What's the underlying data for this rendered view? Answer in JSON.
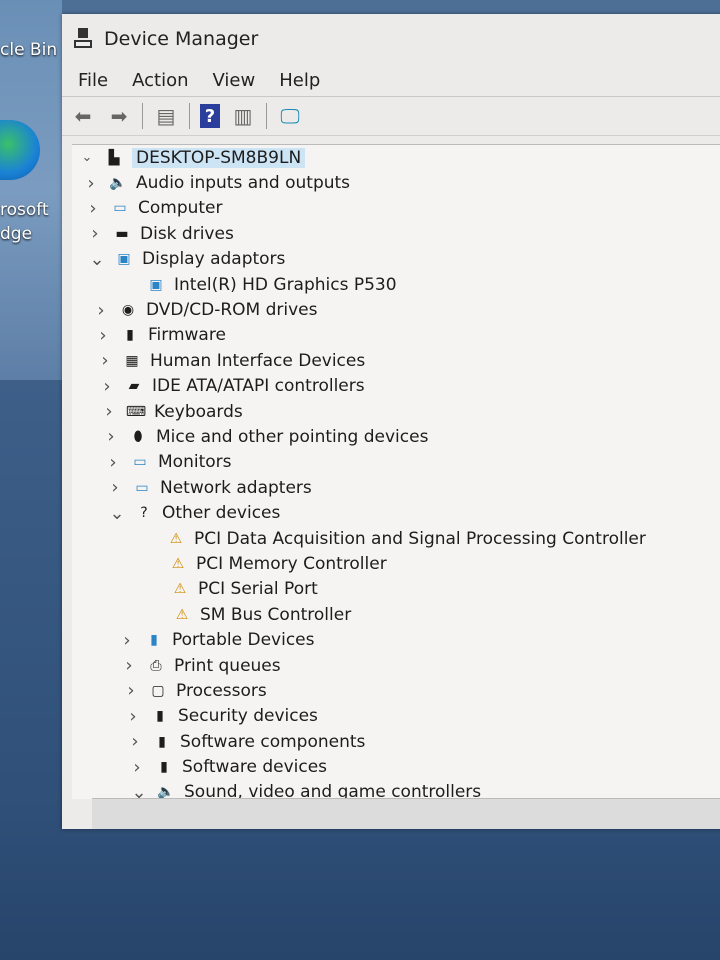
{
  "desktop": {
    "labels": [
      "cle Bin",
      "rosoft",
      "dge"
    ]
  },
  "window": {
    "title": "Device Manager"
  },
  "menu": [
    "File",
    "Action",
    "View",
    "Help"
  ],
  "tree": {
    "root": "DESKTOP-SM8B9LN",
    "items": [
      {
        "label": "Audio inputs and outputs",
        "state": "collapsed",
        "icon": "speaker-icon",
        "level": 1
      },
      {
        "label": "Computer",
        "state": "collapsed",
        "icon": "monitor-icon",
        "level": 1
      },
      {
        "label": "Disk drives",
        "state": "collapsed",
        "icon": "disk-icon",
        "level": 1
      },
      {
        "label": "Display adaptors",
        "state": "expanded",
        "icon": "display-adapter-icon",
        "level": 1
      },
      {
        "label": "Intel(R) HD Graphics P530",
        "state": "leaf",
        "icon": "display-adapter-icon",
        "level": 2
      },
      {
        "label": "DVD/CD-ROM drives",
        "state": "collapsed",
        "icon": "dvd-icon",
        "level": 1
      },
      {
        "label": "Firmware",
        "state": "collapsed",
        "icon": "firmware-icon",
        "level": 1
      },
      {
        "label": "Human Interface Devices",
        "state": "collapsed",
        "icon": "hid-icon",
        "level": 1
      },
      {
        "label": "IDE ATA/ATAPI controllers",
        "state": "collapsed",
        "icon": "ide-icon",
        "level": 1
      },
      {
        "label": "Keyboards",
        "state": "collapsed",
        "icon": "keyboard-icon",
        "level": 1
      },
      {
        "label": "Mice and other pointing devices",
        "state": "collapsed",
        "icon": "mouse-icon",
        "level": 1
      },
      {
        "label": "Monitors",
        "state": "collapsed",
        "icon": "monitor-icon",
        "level": 1
      },
      {
        "label": "Network adapters",
        "state": "collapsed",
        "icon": "network-icon",
        "level": 1
      },
      {
        "label": "Other devices",
        "state": "expanded",
        "icon": "unknown-device-icon",
        "level": 1
      },
      {
        "label": "PCI Data Acquisition and Signal Processing Controller",
        "state": "leaf",
        "icon": "warning-device-icon",
        "level": 2
      },
      {
        "label": "PCI Memory Controller",
        "state": "leaf",
        "icon": "warning-device-icon",
        "level": 2
      },
      {
        "label": "PCI Serial Port",
        "state": "leaf",
        "icon": "warning-device-icon",
        "level": 2
      },
      {
        "label": "SM Bus Controller",
        "state": "leaf",
        "icon": "warning-device-icon",
        "level": 2
      },
      {
        "label": "Portable Devices",
        "state": "collapsed",
        "icon": "portable-icon",
        "level": 1
      },
      {
        "label": "Print queues",
        "state": "collapsed",
        "icon": "printer-icon",
        "level": 1
      },
      {
        "label": "Processors",
        "state": "collapsed",
        "icon": "processor-icon",
        "level": 1
      },
      {
        "label": "Security devices",
        "state": "collapsed",
        "icon": "security-icon",
        "level": 1
      },
      {
        "label": "Software components",
        "state": "collapsed",
        "icon": "software-component-icon",
        "level": 1
      },
      {
        "label": "Software devices",
        "state": "collapsed",
        "icon": "software-device-icon",
        "level": 1
      },
      {
        "label": "Sound, video and game controllers",
        "state": "expanded",
        "icon": "speaker-icon",
        "level": 1
      }
    ]
  }
}
